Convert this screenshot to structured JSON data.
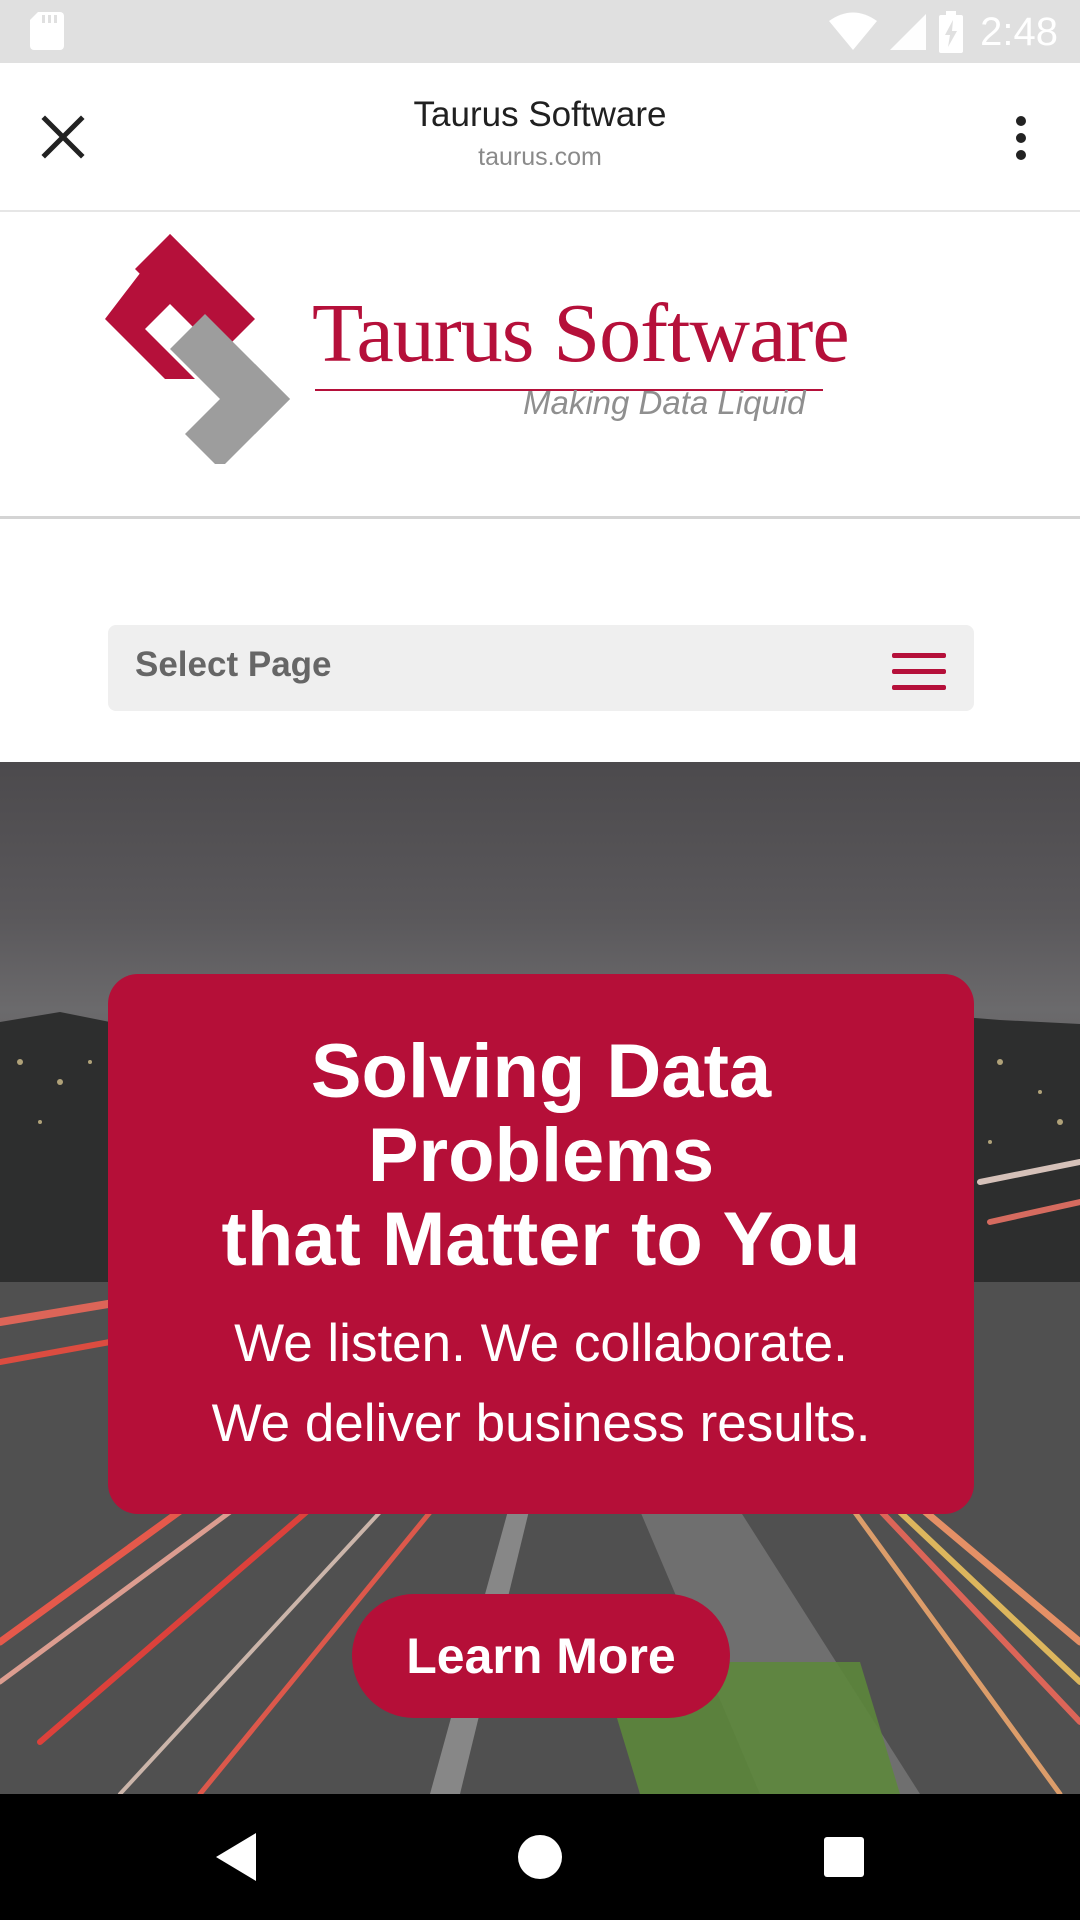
{
  "status_bar": {
    "time": "2:48",
    "icons": [
      "sd-card-icon",
      "wifi-icon",
      "signal-icon",
      "battery-charging-icon"
    ]
  },
  "toolbar": {
    "title": "Taurus Software",
    "url": "taurus.com",
    "icons": [
      "close-icon",
      "more-vert-icon"
    ]
  },
  "logo": {
    "name": "Taurus Software",
    "tagline": "Making Data Liquid"
  },
  "nav": {
    "select_label": "Select Page",
    "icon": "hamburger-menu-icon"
  },
  "hero": {
    "title_line1": "Solving Data",
    "title_line2": "Problems",
    "title_line3": "that Matter to You",
    "subtitle_line1": "We listen. We collaborate.",
    "subtitle_line2": "We deliver business results.",
    "cta_label": "Learn More"
  },
  "android_nav": {
    "icons": [
      "back-icon",
      "home-icon",
      "recents-icon"
    ]
  },
  "colors": {
    "brand": "#b50f38",
    "status_bar": "#e0e0e0",
    "tagline_gray": "#8f8f8f"
  }
}
